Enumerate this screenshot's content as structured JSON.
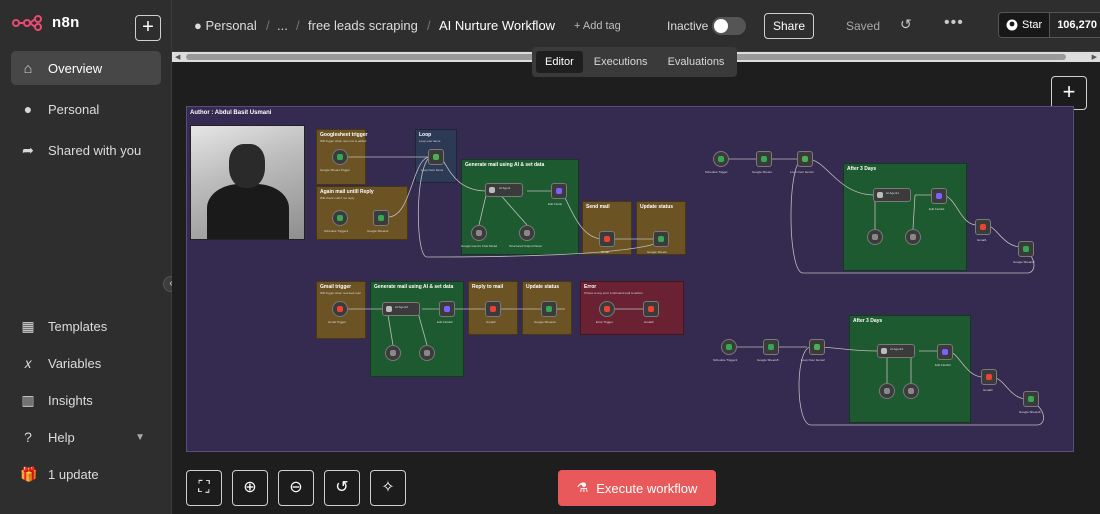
{
  "brand": {
    "name": "n8n",
    "logo_icon": "n8n-logo-icon"
  },
  "sidebar": {
    "add_label": "+",
    "items": [
      {
        "label": "Overview",
        "icon": "home-icon",
        "active": true
      },
      {
        "label": "Personal",
        "icon": "user-icon",
        "active": false
      },
      {
        "label": "Shared with you",
        "icon": "share-icon",
        "active": false
      }
    ],
    "bottom_items": [
      {
        "label": "Templates",
        "icon": "templates-icon"
      },
      {
        "label": "Variables",
        "icon": "variables-icon"
      },
      {
        "label": "Insights",
        "icon": "insights-icon"
      },
      {
        "label": "Help",
        "icon": "help-icon"
      },
      {
        "label": "1 update",
        "icon": "gift-icon"
      }
    ]
  },
  "header": {
    "breadcrumb": [
      "Personal",
      "...",
      "free leads scraping"
    ],
    "separator": "/",
    "workflow_title": "AI Nurture Workflow",
    "add_tag": "+ Add tag",
    "status_label": "Inactive",
    "share_label": "Share",
    "saved_label": "Saved",
    "github": {
      "label": "Star",
      "count": "106,270"
    }
  },
  "canvas": {
    "tabs": [
      {
        "label": "Editor",
        "active": true
      },
      {
        "label": "Executions",
        "active": false
      },
      {
        "label": "Evaluations",
        "active": false
      }
    ],
    "group_title": "Author : Abdul Basit Usmani",
    "stickies": [
      {
        "title": "Googlesheet trigger",
        "subtitle": "Will trigger when new row is added",
        "color": "y"
      },
      {
        "title": "Again mail untill Reply",
        "subtitle": "Will check mail if not reply",
        "color": "y"
      },
      {
        "title": "Loop",
        "subtitle": "Loop over items",
        "color": "n"
      },
      {
        "title": "Generate mail using AI & set data",
        "subtitle": "",
        "color": "g"
      },
      {
        "title": "Send mail",
        "subtitle": "",
        "color": "y"
      },
      {
        "title": "Update status",
        "subtitle": "",
        "color": "y"
      },
      {
        "title": "After 3 Days",
        "subtitle": "",
        "color": "g"
      },
      {
        "title": "Gmail trigger",
        "subtitle": "Will trigger when received mail",
        "color": "y"
      },
      {
        "title": "Generate mail using AI & set data",
        "subtitle": "",
        "color": "g"
      },
      {
        "title": "Reply to mail",
        "subtitle": "",
        "color": "y"
      },
      {
        "title": "Update status",
        "subtitle": "",
        "color": "y"
      },
      {
        "title": "Error",
        "subtitle": "If there is any error it will send mail to admin",
        "color": "r"
      },
      {
        "title": "After 3 Days",
        "subtitle": "",
        "color": "g"
      }
    ],
    "nodes": {
      "google_sheets_trigger": "Google Sheets Trigger",
      "schedule_trigger1": "Schedule Trigger1",
      "google_sheets1": "Google Sheets1",
      "loop_over_items": "Loop Over Items",
      "ai_agent": "AI Agent",
      "edit_fields": "Edit Fields",
      "gemini_chat_model": "Google Gemini Chat Model",
      "structured_output_parser": "Structured Output Parser",
      "gmail": "Gmail",
      "google_sheets": "Google Sheets",
      "schedule_trigger": "Schedule Trigger",
      "google_sheets2": "Google Sheets",
      "loop_over_items1": "Loop Over Items1",
      "ai_agent1": "AI Agent1",
      "edit_fields1": "Edit Fields1",
      "gmail1": "Gmail1",
      "google_sheets3": "Google Sheets3",
      "gmail_trigger": "Gmail Trigger",
      "ai_agent2": "AI Agent2",
      "edit_fields2": "Edit Fields2",
      "gmail2": "Gmail2",
      "google_sheets4": "Google Sheets4",
      "error_trigger": "Error Trigger",
      "gmail3": "Gmail3",
      "schedule_trigger2": "Schedule Trigger2",
      "google_sheets5": "Google Sheets5",
      "loop_over_items2": "Loop Over Items2",
      "ai_agent3": "AI Agent3",
      "edit_fields3": "Edit Fields3",
      "gmail4": "Gmail4",
      "google_sheets6": "Google Sheets6"
    },
    "controls": [
      "fit-view-icon",
      "zoom-in-icon",
      "zoom-out-icon",
      "reset-zoom-icon",
      "tidy-up-icon"
    ],
    "execute_label": "Execute workflow"
  },
  "colors": {
    "accent": "#e8595b",
    "sticky_yellow": "#6b5323",
    "sticky_green": "#1e5a30",
    "sticky_red": "#6a2232",
    "group_bg": "#352a4f"
  }
}
